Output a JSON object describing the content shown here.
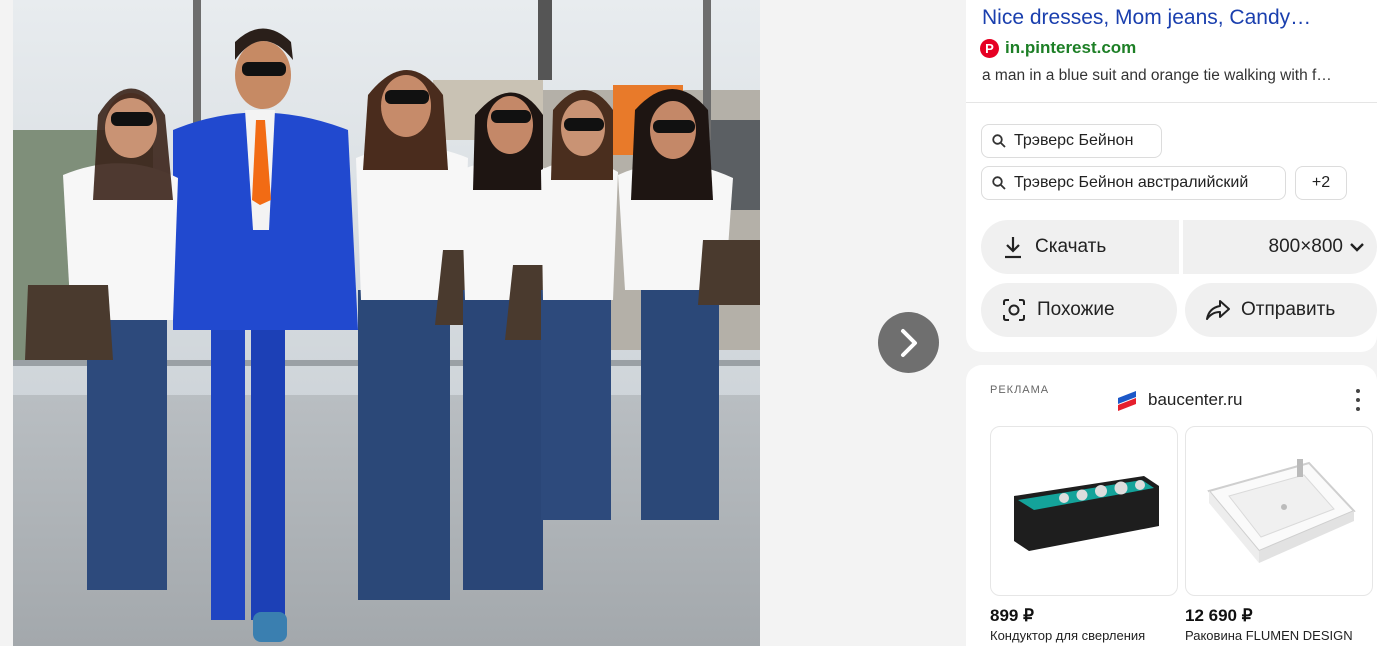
{
  "viewer": {
    "image_alt": "a man in a blue suit and orange tie walking with five women",
    "next_label": "›"
  },
  "source": {
    "title": "Nice dresses, Mom jeans, Candy…",
    "site": "in.pinterest.com",
    "description": "a man in a blue suit and orange tie walking with f…"
  },
  "tags": [
    "Трэверс Бейнон",
    "Трэверс Бейнон австралийский"
  ],
  "tags_more": "+2",
  "actions": {
    "download": "Скачать",
    "size": "800×800",
    "similar": "Похожие",
    "share": "Отправить"
  },
  "ad": {
    "label": "РЕКЛАМА",
    "brand": "baucenter.ru",
    "products": [
      {
        "price": "899 ₽",
        "name": "Кондуктор для сверления"
      },
      {
        "price": "12 690 ₽",
        "name": "Раковина FLUMEN DESIGN"
      }
    ]
  },
  "colors": {
    "title_link": "#1a3fae",
    "site_green": "#1d7f26",
    "pinterest_red": "#e60023",
    "suit_blue": "#1f45c2",
    "tie_orange": "#f26b14"
  }
}
